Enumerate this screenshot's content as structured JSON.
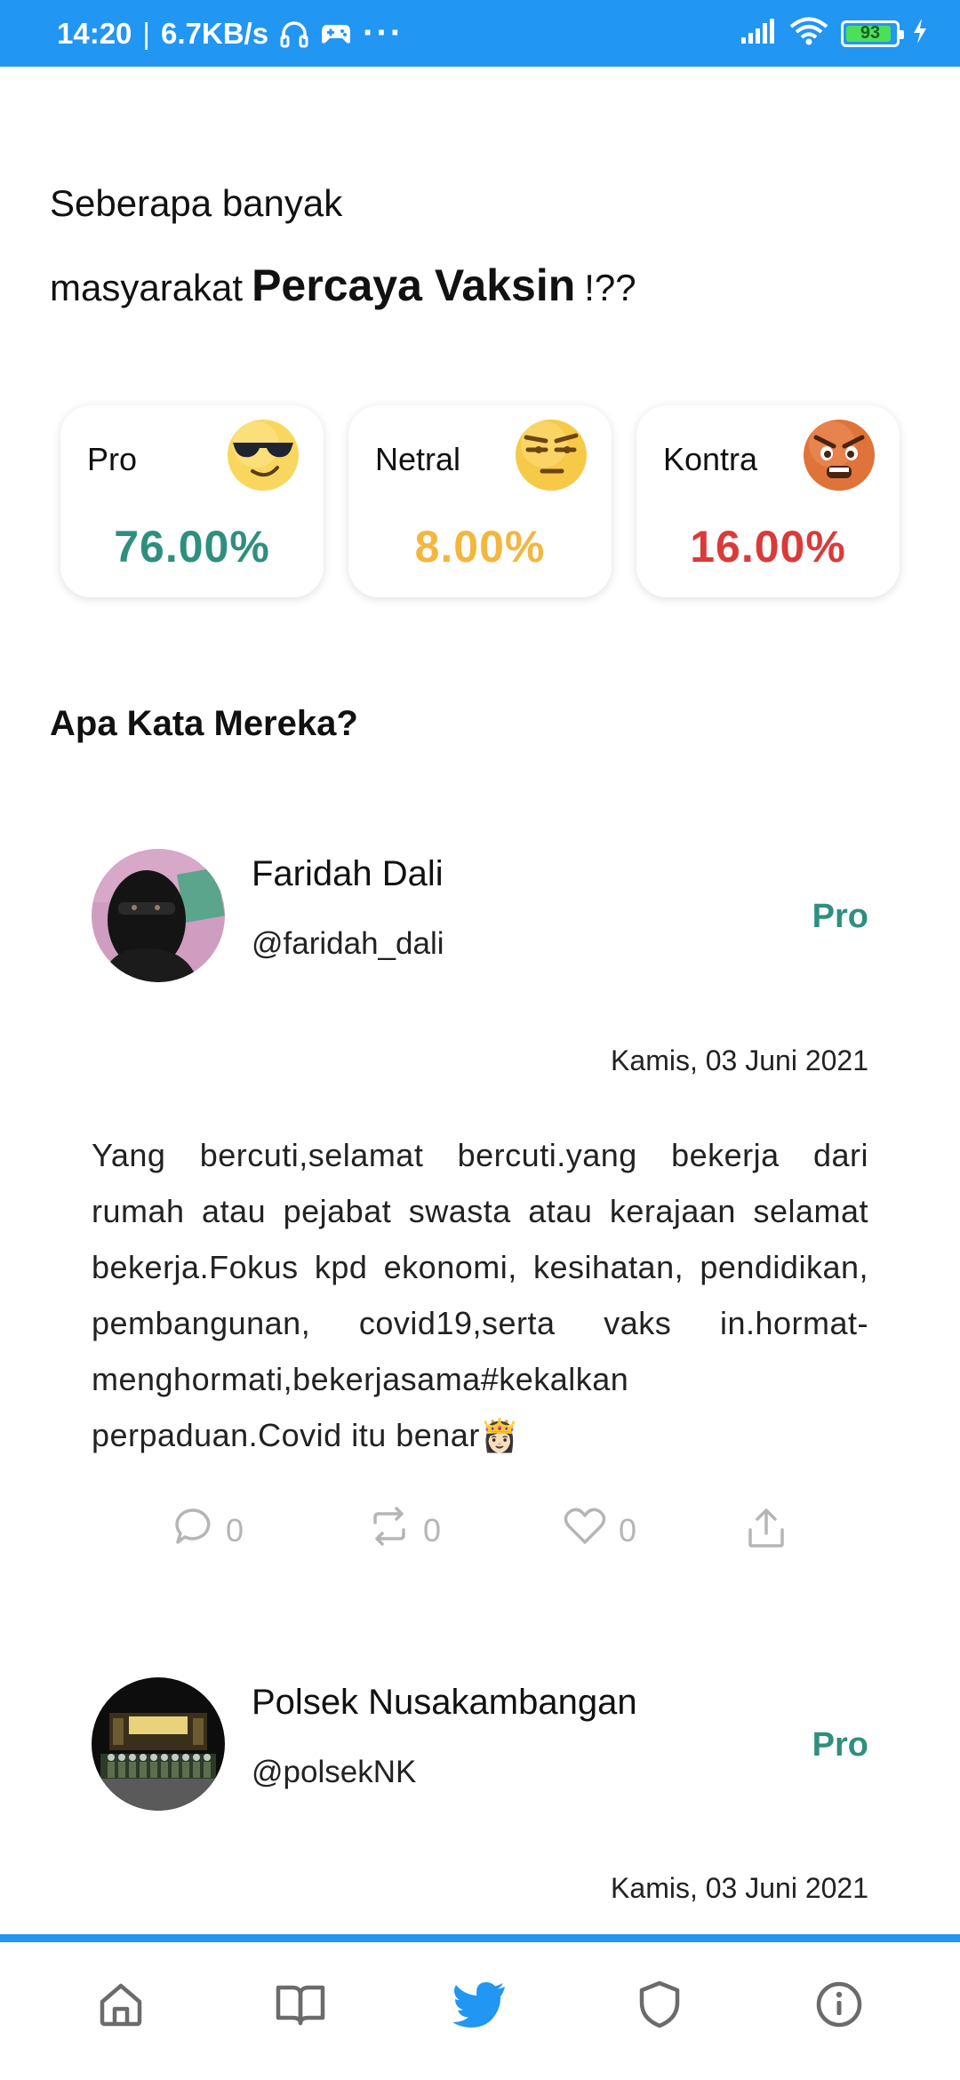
{
  "status_bar": {
    "time": "14:20",
    "speed": "6.7KB/s",
    "dots": "···",
    "battery": "93",
    "battery_level": 0.93,
    "color": "#2196F3"
  },
  "header": {
    "line1": "Seberapa banyak",
    "line2_prefix": "masyarakat",
    "line2_emphasis": "Percaya Vaksin",
    "line2_suffix": "!??"
  },
  "stats": [
    {
      "label": "Pro",
      "value": "76.00%",
      "color": "#2f8f7e",
      "icon": "cool-sunglasses-emoji-icon"
    },
    {
      "label": "Netral",
      "value": "8.00%",
      "color": "#f4b63f",
      "icon": "skeptical-face-emoji-icon"
    },
    {
      "label": "Kontra",
      "value": "16.00%",
      "color": "#db3a3a",
      "icon": "angry-face-emoji-icon"
    }
  ],
  "section_title": "Apa Kata Mereka?",
  "posts": [
    {
      "name": "Faridah Dali",
      "handle": "@faridah_dali",
      "stance": "Pro",
      "date": "Kamis, 03 Juni 2021",
      "text": "Yang bercuti,selamat bercuti.yang bekerja dari rumah atau pejabat swasta atau kerajaan selamat bekerja.Fokus kpd ekonomi, kesihatan, pendidikan, pembangunan, covid19,serta vaks in.hormat-menghormati,bekerjasama#kekalkan perpaduan.Covid itu benar👸🏻",
      "replies": "0",
      "retweets": "0",
      "likes": "0"
    },
    {
      "name": "Polsek Nusakambangan",
      "handle": "@polsekNK",
      "stance": "Pro",
      "date": "Kamis, 03 Juni 2021"
    }
  ],
  "bottom_nav": {
    "items": [
      "home-icon",
      "book-icon",
      "twitter-bird-icon",
      "shield-icon",
      "info-icon"
    ],
    "active": "twitter-bird-icon",
    "active_color": "#2196F3"
  }
}
